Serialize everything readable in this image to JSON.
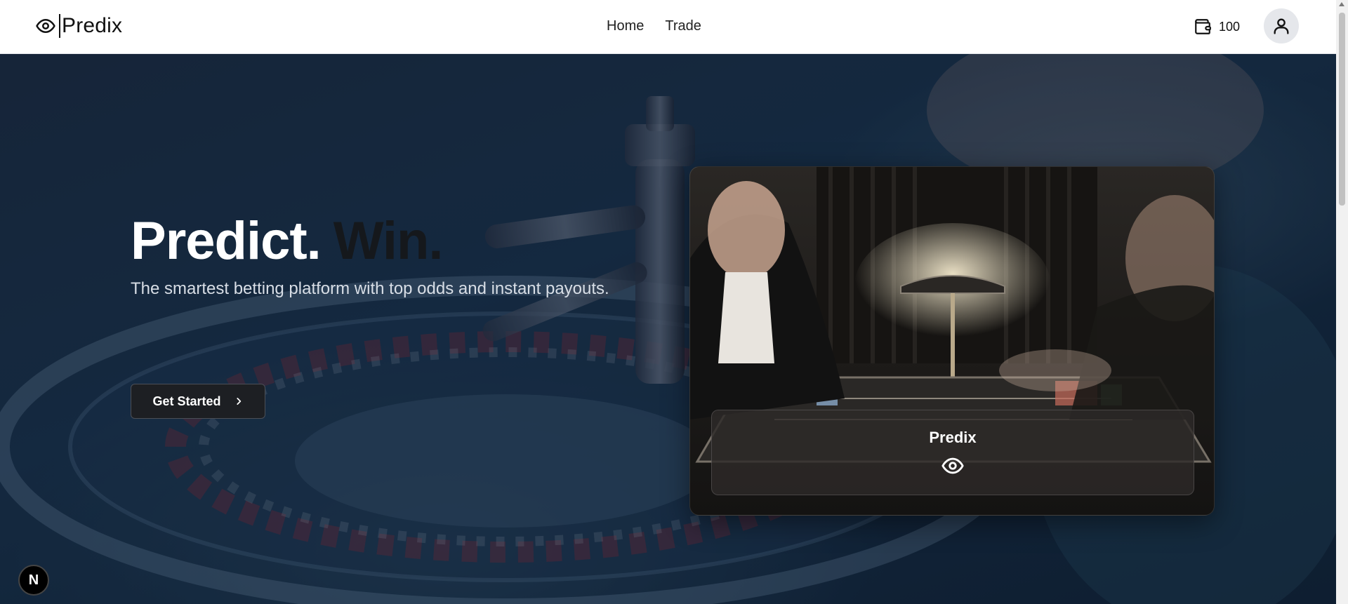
{
  "navbar": {
    "logo_text": "Predix",
    "logo_icon": "eye-icon",
    "links": [
      {
        "label": "Home"
      },
      {
        "label": "Trade"
      }
    ],
    "wallet": {
      "icon": "wallet-icon",
      "balance": "100"
    },
    "avatar_icon": "user-icon"
  },
  "hero": {
    "headline_part1": "Predict.",
    "headline_part2": "Win.",
    "subtitle": "The smartest betting platform with top odds and instant payouts.",
    "cta_label": "Get Started",
    "cta_icon": "chevron-right-icon"
  },
  "card": {
    "title": "Predix",
    "icon": "eye-icon"
  },
  "dev_badge": {
    "label": "N"
  },
  "colors": {
    "accent_dark": "#1d1f23",
    "hero_blue": "#18324a",
    "white": "#ffffff"
  }
}
